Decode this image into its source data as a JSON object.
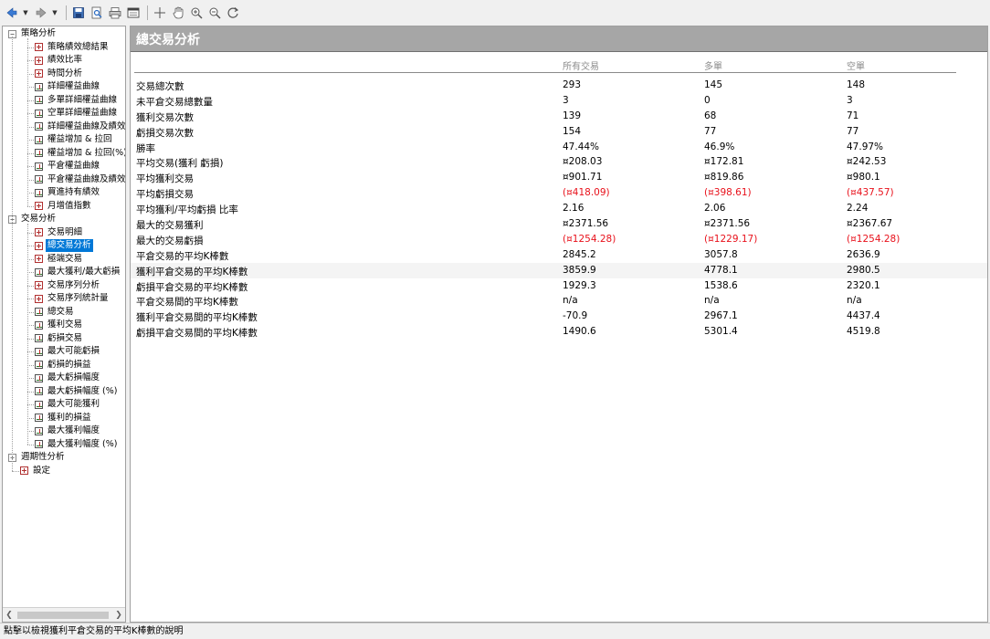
{
  "toolbar": {
    "buttons": [
      "back-icon",
      "forward-icon",
      "save-icon",
      "print-preview-icon",
      "print-icon",
      "window-icon",
      "crosshair-icon",
      "hand-pan-icon",
      "zoom-in-icon",
      "zoom-out-icon",
      "refresh-icon"
    ]
  },
  "tree": {
    "groups": [
      {
        "label": "策略分析",
        "expander": "−",
        "items": [
          {
            "label": "策略績效總結果",
            "icon": "report"
          },
          {
            "label": "績效比率",
            "icon": "report"
          },
          {
            "label": "時間分析",
            "icon": "report"
          },
          {
            "label": "詳細權益曲線",
            "icon": "chart"
          },
          {
            "label": "多單詳細權益曲線",
            "icon": "chart"
          },
          {
            "label": "空單詳細權益曲線",
            "icon": "chart"
          },
          {
            "label": "詳細權益曲線及績效",
            "icon": "chart"
          },
          {
            "label": "權益增加 & 拉回",
            "icon": "chart"
          },
          {
            "label": "權益增加 & 拉回(%)",
            "icon": "chart"
          },
          {
            "label": "平倉權益曲線",
            "icon": "chart"
          },
          {
            "label": "平倉權益曲線及績效",
            "icon": "chart"
          },
          {
            "label": "買進持有績效",
            "icon": "chart"
          },
          {
            "label": "月增值指數",
            "icon": "report"
          }
        ]
      },
      {
        "label": "交易分析",
        "expander": "−",
        "items": [
          {
            "label": "交易明細",
            "icon": "report"
          },
          {
            "label": "總交易分析",
            "icon": "report",
            "selected": true
          },
          {
            "label": "極端交易",
            "icon": "report"
          },
          {
            "label": "最大獲利/最大虧損",
            "icon": "chart"
          },
          {
            "label": "交易序列分析",
            "icon": "report"
          },
          {
            "label": "交易序列統計量",
            "icon": "report"
          },
          {
            "label": "總交易",
            "icon": "chart"
          },
          {
            "label": "獲利交易",
            "icon": "chart"
          },
          {
            "label": "虧損交易",
            "icon": "chart"
          },
          {
            "label": "最大可能虧損",
            "icon": "chart"
          },
          {
            "label": "虧損的損益",
            "icon": "chart"
          },
          {
            "label": "最大虧損幅度",
            "icon": "chart"
          },
          {
            "label": "最大虧損幅度 (%)",
            "icon": "chart"
          },
          {
            "label": "最大可能獲利",
            "icon": "chart"
          },
          {
            "label": "獲利的損益",
            "icon": "chart"
          },
          {
            "label": "最大獲利幅度",
            "icon": "chart"
          },
          {
            "label": "最大獲利幅度 (%)",
            "icon": "chart"
          }
        ]
      },
      {
        "label": "週期性分析",
        "expander": "+",
        "items": []
      }
    ],
    "settings_label": "設定"
  },
  "main": {
    "title": "總交易分析",
    "columns": [
      "所有交易",
      "多單",
      "空單"
    ],
    "rows": [
      {
        "label": "交易總次數",
        "all": "293",
        "long": "145",
        "short": "148"
      },
      {
        "label": "未平倉交易總數量",
        "all": "3",
        "long": "0",
        "short": "3"
      },
      {
        "label": "獲利交易次數",
        "all": "139",
        "long": "68",
        "short": "71"
      },
      {
        "label": "虧損交易次數",
        "all": "154",
        "long": "77",
        "short": "77"
      },
      {
        "label": "勝率",
        "all": "47.44%",
        "long": "46.9%",
        "short": "47.97%"
      },
      {
        "label": "平均交易(獲利 虧損)",
        "all": "¤208.03",
        "long": "¤172.81",
        "short": "¤242.53"
      },
      {
        "label": "平均獲利交易",
        "all": "¤901.71",
        "long": "¤819.86",
        "short": "¤980.1"
      },
      {
        "label": "平均虧損交易",
        "all": "(¤418.09)",
        "long": "(¤398.61)",
        "short": "(¤437.57)",
        "negative": true
      },
      {
        "label": "平均獲利/平均虧損 比率",
        "all": "2.16",
        "long": "2.06",
        "short": "2.24"
      },
      {
        "label": "最大的交易獲利",
        "all": "¤2371.56",
        "long": "¤2371.56",
        "short": "¤2367.67"
      },
      {
        "label": "最大的交易虧損",
        "all": "(¤1254.28)",
        "long": "(¤1229.17)",
        "short": "(¤1254.28)",
        "negative": true
      },
      {
        "label": "平倉交易的平均K棒數",
        "all": "2845.2",
        "long": "3057.8",
        "short": "2636.9"
      },
      {
        "label": "獲利平倉交易的平均K棒數",
        "all": "3859.9",
        "long": "4778.1",
        "short": "2980.5",
        "highlight": true
      },
      {
        "label": "虧損平倉交易的平均K棒數",
        "all": "1929.3",
        "long": "1538.6",
        "short": "2320.1"
      },
      {
        "label": "平倉交易間的平均K棒數",
        "all": "n/a",
        "long": "n/a",
        "short": "n/a"
      },
      {
        "label": "獲利平倉交易間的平均K棒數",
        "all": "-70.9",
        "long": "2967.1",
        "short": "4437.4"
      },
      {
        "label": "虧損平倉交易間的平均K棒數",
        "all": "1490.6",
        "long": "5301.4",
        "short": "4519.8"
      }
    ]
  },
  "statusbar": {
    "text": "點擊以檢視獲利平倉交易的平均K棒數的說明"
  },
  "colors": {
    "header_bg": "#a6a6a6",
    "negative": "#e8111b",
    "selection": "#0078d7"
  }
}
